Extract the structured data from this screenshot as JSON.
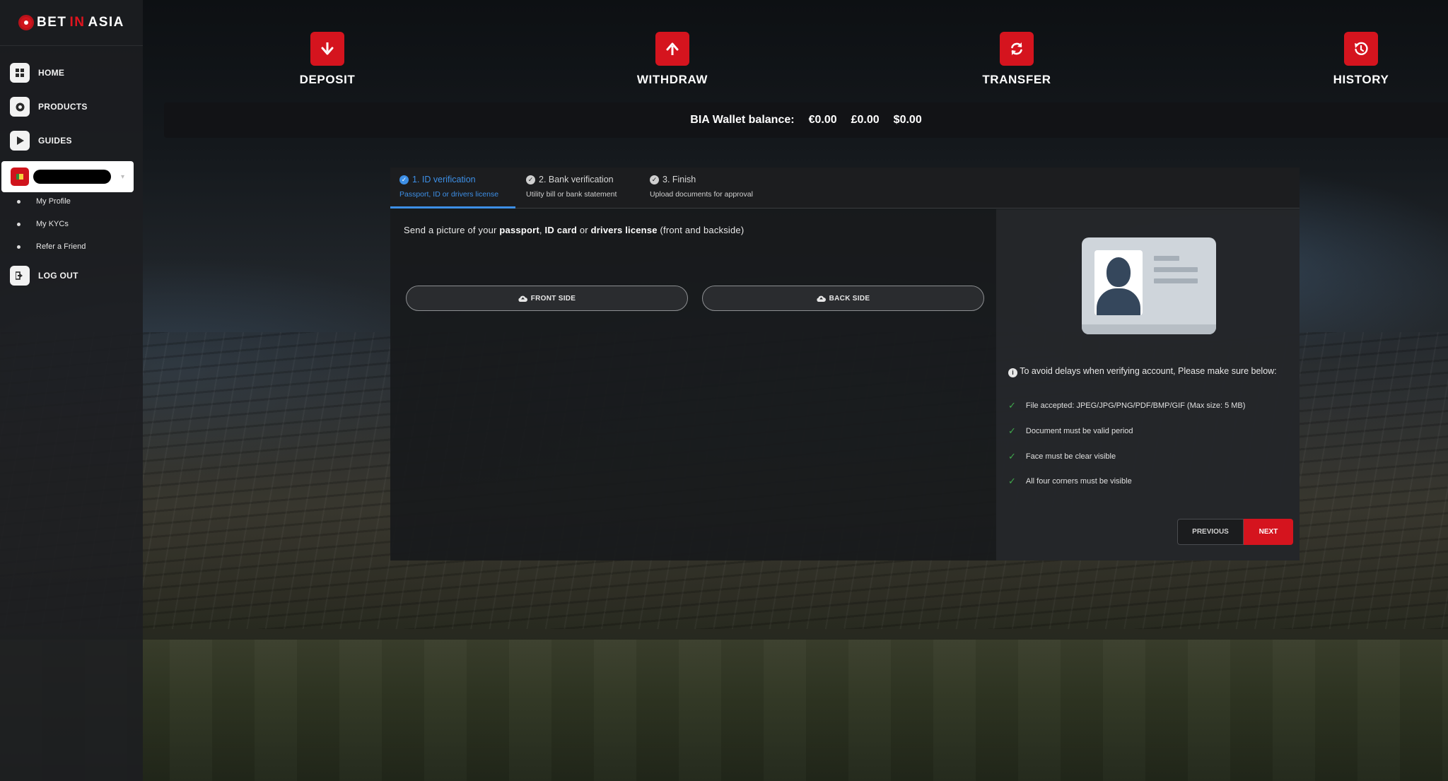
{
  "brand": {
    "logo_text_a": "BET",
    "logo_text_b": "IN",
    "logo_text_c": "ASIA"
  },
  "sidebar": {
    "nav": [
      {
        "label": "HOME",
        "icon": "grid-icon"
      },
      {
        "label": "PRODUCTS",
        "icon": "chip-icon"
      },
      {
        "label": "GUIDES",
        "icon": "play-icon"
      }
    ],
    "account_submenu": [
      "My Profile",
      "My KYCs",
      "Refer a Friend"
    ],
    "logout_label": "LOG OUT"
  },
  "actions": [
    {
      "label": "DEPOSIT",
      "icon": "arrow-down-icon"
    },
    {
      "label": "WITHDRAW",
      "icon": "arrow-up-icon"
    },
    {
      "label": "TRANSFER",
      "icon": "refresh-icon"
    },
    {
      "label": "HISTORY",
      "icon": "history-icon"
    }
  ],
  "wallet": {
    "label": "BIA Wallet balance:",
    "eur": "€0.00",
    "gbp": "£0.00",
    "usd": "$0.00"
  },
  "kyc": {
    "steps": [
      {
        "title": "1. ID verification",
        "subtitle": "Passport, ID or drivers license"
      },
      {
        "title": "2. Bank verification",
        "subtitle": "Utility bill or bank statement"
      },
      {
        "title": "3. Finish",
        "subtitle": "Upload documents for approval"
      }
    ],
    "instruction": {
      "a": "Send a picture of your ",
      "b": "passport",
      "c": ", ",
      "d": "ID card",
      "e": " or ",
      "f": "drivers license",
      "g": " (front and backside)"
    },
    "front_label": "FRONT SIDE",
    "back_label": "BACK SIDE",
    "tip_heading": "To avoid delays when verifying account, Please make sure below:",
    "rules": [
      "File accepted: JPEG/JPG/PNG/PDF/BMP/GIF (Max size: 5 MB)",
      "Document must be valid period",
      "Face must be clear visible",
      "All four corners must be visible"
    ],
    "prev_label": "PREVIOUS",
    "next_label": "NEXT"
  },
  "colors": {
    "accent": "#d5141e",
    "active_step": "#3d8fe6",
    "check": "#3fa84c"
  }
}
